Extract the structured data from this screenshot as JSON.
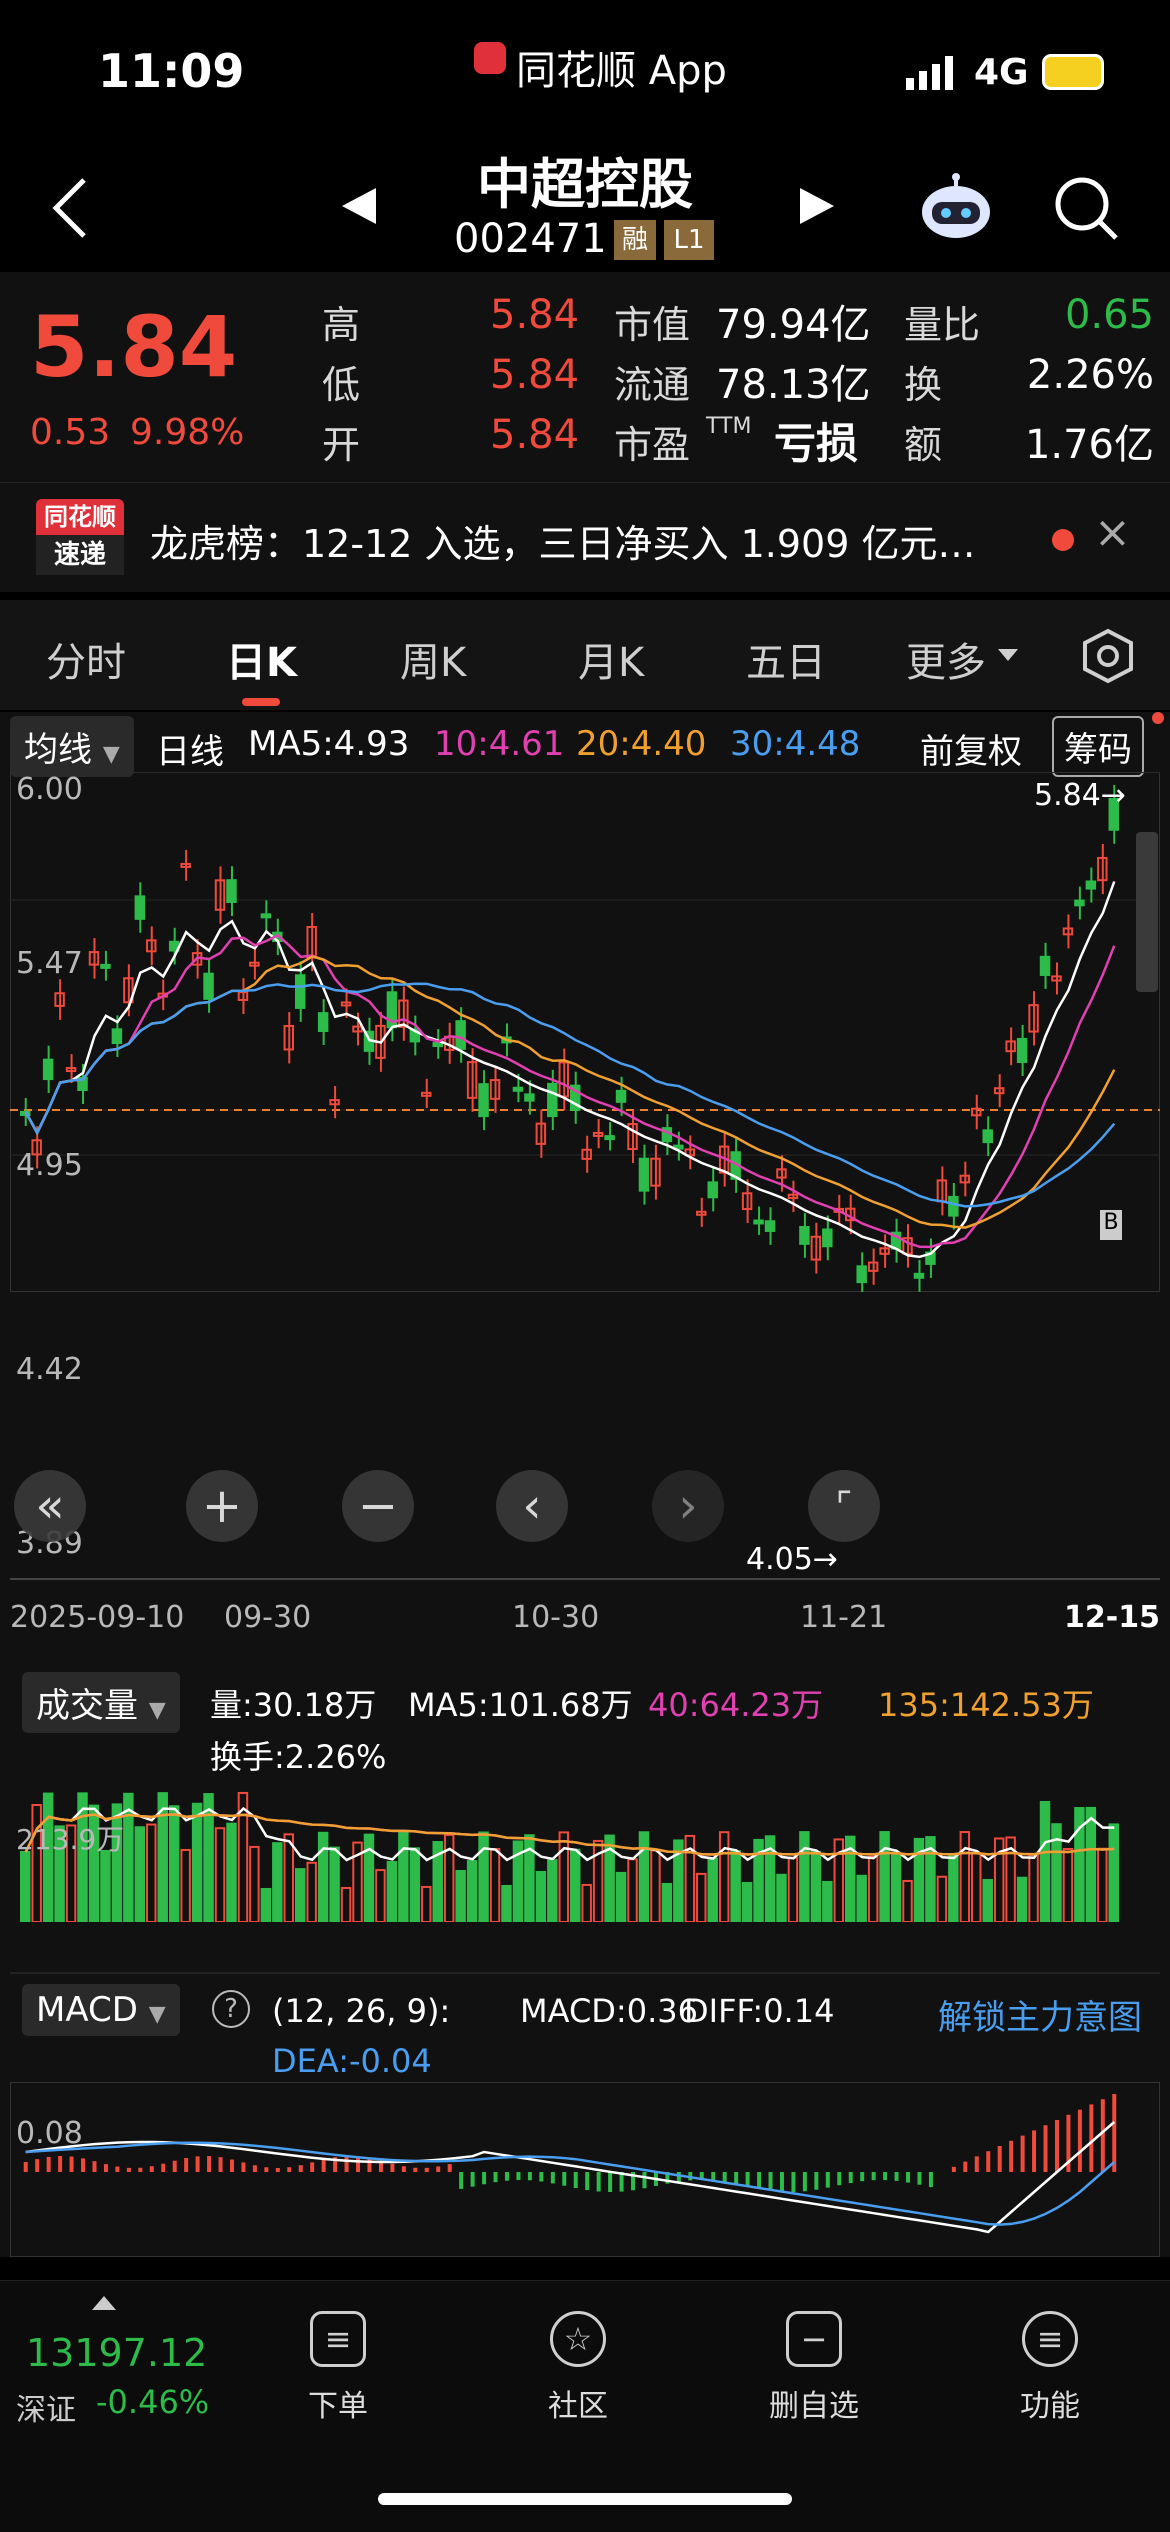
{
  "status": {
    "time": "11:09",
    "app": "同花顺 App",
    "network": "4G"
  },
  "header": {
    "name": "中超控股",
    "code": "002471",
    "badge1": "融",
    "badge2": "L1"
  },
  "quote": {
    "price": "5.84",
    "change": "0.53",
    "change_pct": "9.98%",
    "high_label": "高",
    "high": "5.84",
    "low_label": "低",
    "low": "5.84",
    "open_label": "开",
    "open": "5.84",
    "mktcap_label": "市值",
    "mktcap": "79.94亿",
    "float_label": "流通",
    "float": "78.13亿",
    "pe_label": "市盈",
    "pe_sup": "TTM",
    "pe": "亏损",
    "vr_label": "量比",
    "vr": "0.65",
    "turnover_label": "换",
    "turnover": "2.26%",
    "amount_label": "额",
    "amount": "1.76亿"
  },
  "news": {
    "logo_top": "同花顺",
    "logo_bottom": "速递",
    "text": "龙虎榜：12-12 入选，三日净买入 1.909 亿元…"
  },
  "tabs": [
    "分时",
    "日K",
    "周K",
    "月K",
    "五日",
    "更多"
  ],
  "ma_bar": {
    "selector": "均线",
    "type": "日线",
    "ma5": "MA5:4.93",
    "ma10": "10:4.61",
    "ma20": "20:4.40",
    "ma30": "30:4.48",
    "adjust": "前复权",
    "chips": "筹码"
  },
  "kline": {
    "y_labels": [
      "6.00",
      "5.47",
      "4.95",
      "4.42",
      "3.89"
    ],
    "high_marker": "5.84→",
    "low_marker": "4.05→",
    "dates": [
      "2025-09-10",
      "09-30",
      "10-30",
      "11-21",
      "12-15"
    ],
    "b_marker": "B"
  },
  "volume": {
    "selector": "成交量",
    "vol": "量:30.18万",
    "ma5": "MA5:101.68万",
    "ma40": "40:64.23万",
    "ma135": "135:142.53万",
    "turnover": "换手:2.26%",
    "y_label": "213.9万"
  },
  "macd": {
    "selector": "MACD",
    "help": "?",
    "params": "(12, 26, 9):",
    "macd": "MACD:0.36",
    "diff": "DIFF:0.14",
    "dea": "DEA:-0.04",
    "unlock": "解锁主力意图",
    "y_label": "0.08"
  },
  "bottom": {
    "index_value": "13197.12",
    "index_name": "深证",
    "index_change": "-0.46%",
    "nav": [
      "下单",
      "社区",
      "删自选",
      "功能"
    ]
  },
  "colors": {
    "up": "#f04a3c",
    "down": "#2dbb4a",
    "ma5": "#ffffff",
    "ma10": "#e040b0",
    "ma20": "#f0a030",
    "ma30": "#4a9ef0"
  }
}
